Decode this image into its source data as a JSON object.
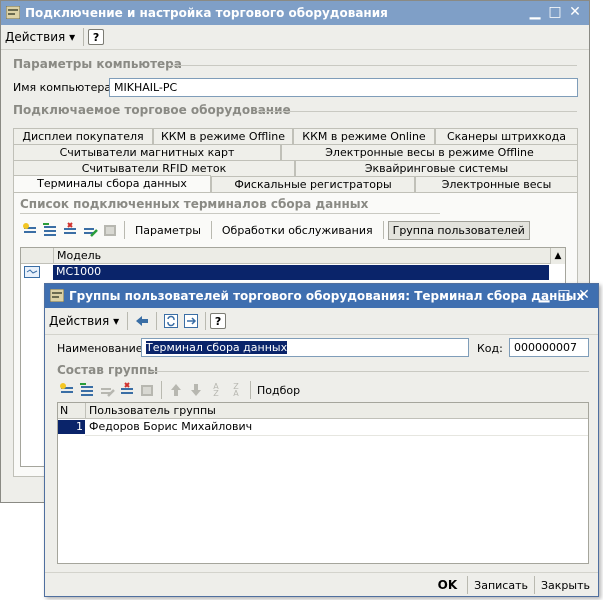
{
  "main_window": {
    "title": "Подключение и настройка торгового оборудования",
    "menu_label": "Действия",
    "help_label": "?",
    "computer_params_header": "Параметры компьютера",
    "computer_name_label": "Имя компьютера:",
    "computer_name_value": "MIKHAIL-PC",
    "equipment_header": "Подключаемое торговое оборудование",
    "tabs_row1": [
      "Дисплеи покупателя",
      "ККМ в режиме Offline",
      "ККМ в режиме Online",
      "Сканеры штрихкода"
    ],
    "tabs_row2": [
      "Считыватели магнитных карт",
      "Электронные весы в режиме Offline"
    ],
    "tabs_row3": [
      "Считыватели RFID меток",
      "Эквайринговые системы"
    ],
    "tabs_row4": [
      "Терминалы сбора данных",
      "Фискальные регистраторы",
      "Электронные весы"
    ],
    "list_header": "Список подключенных терминалов сбора данных",
    "toolbar_buttons": [
      "Параметры",
      "Обработки обслуживания",
      "Группа пользователей"
    ],
    "grid_column": "Модель",
    "rows": [
      {
        "model": "MC1000"
      }
    ]
  },
  "dialog": {
    "title": "Группы пользователей торгового оборудования: Терминал сбора данных",
    "menu_label": "Действия",
    "help_label": "?",
    "name_label": "Наименование:",
    "name_value": "Терминал сбора данных",
    "code_label": "Код:",
    "code_value": "000000007",
    "group_header": "Состав группы",
    "select_label": "Подбор",
    "columns": [
      "N",
      "Пользователь группы"
    ],
    "rows": [
      {
        "n": "1",
        "user": "Федоров Борис Михайлович"
      }
    ],
    "ok_label": "OK",
    "save_label": "Записать",
    "close_label": "Закрыть"
  },
  "colors": {
    "titlebar": "#7f9fc7",
    "selection": "#0a246a",
    "window_bg": "#eeeeea"
  },
  "icons": [
    "add-icon",
    "copy-icon",
    "delete-icon",
    "edit-icon",
    "disable-icon",
    "back-icon",
    "refresh-icon",
    "forward-icon",
    "move-up-icon",
    "move-down-icon",
    "sort-asc-icon",
    "sort-desc-icon"
  ]
}
